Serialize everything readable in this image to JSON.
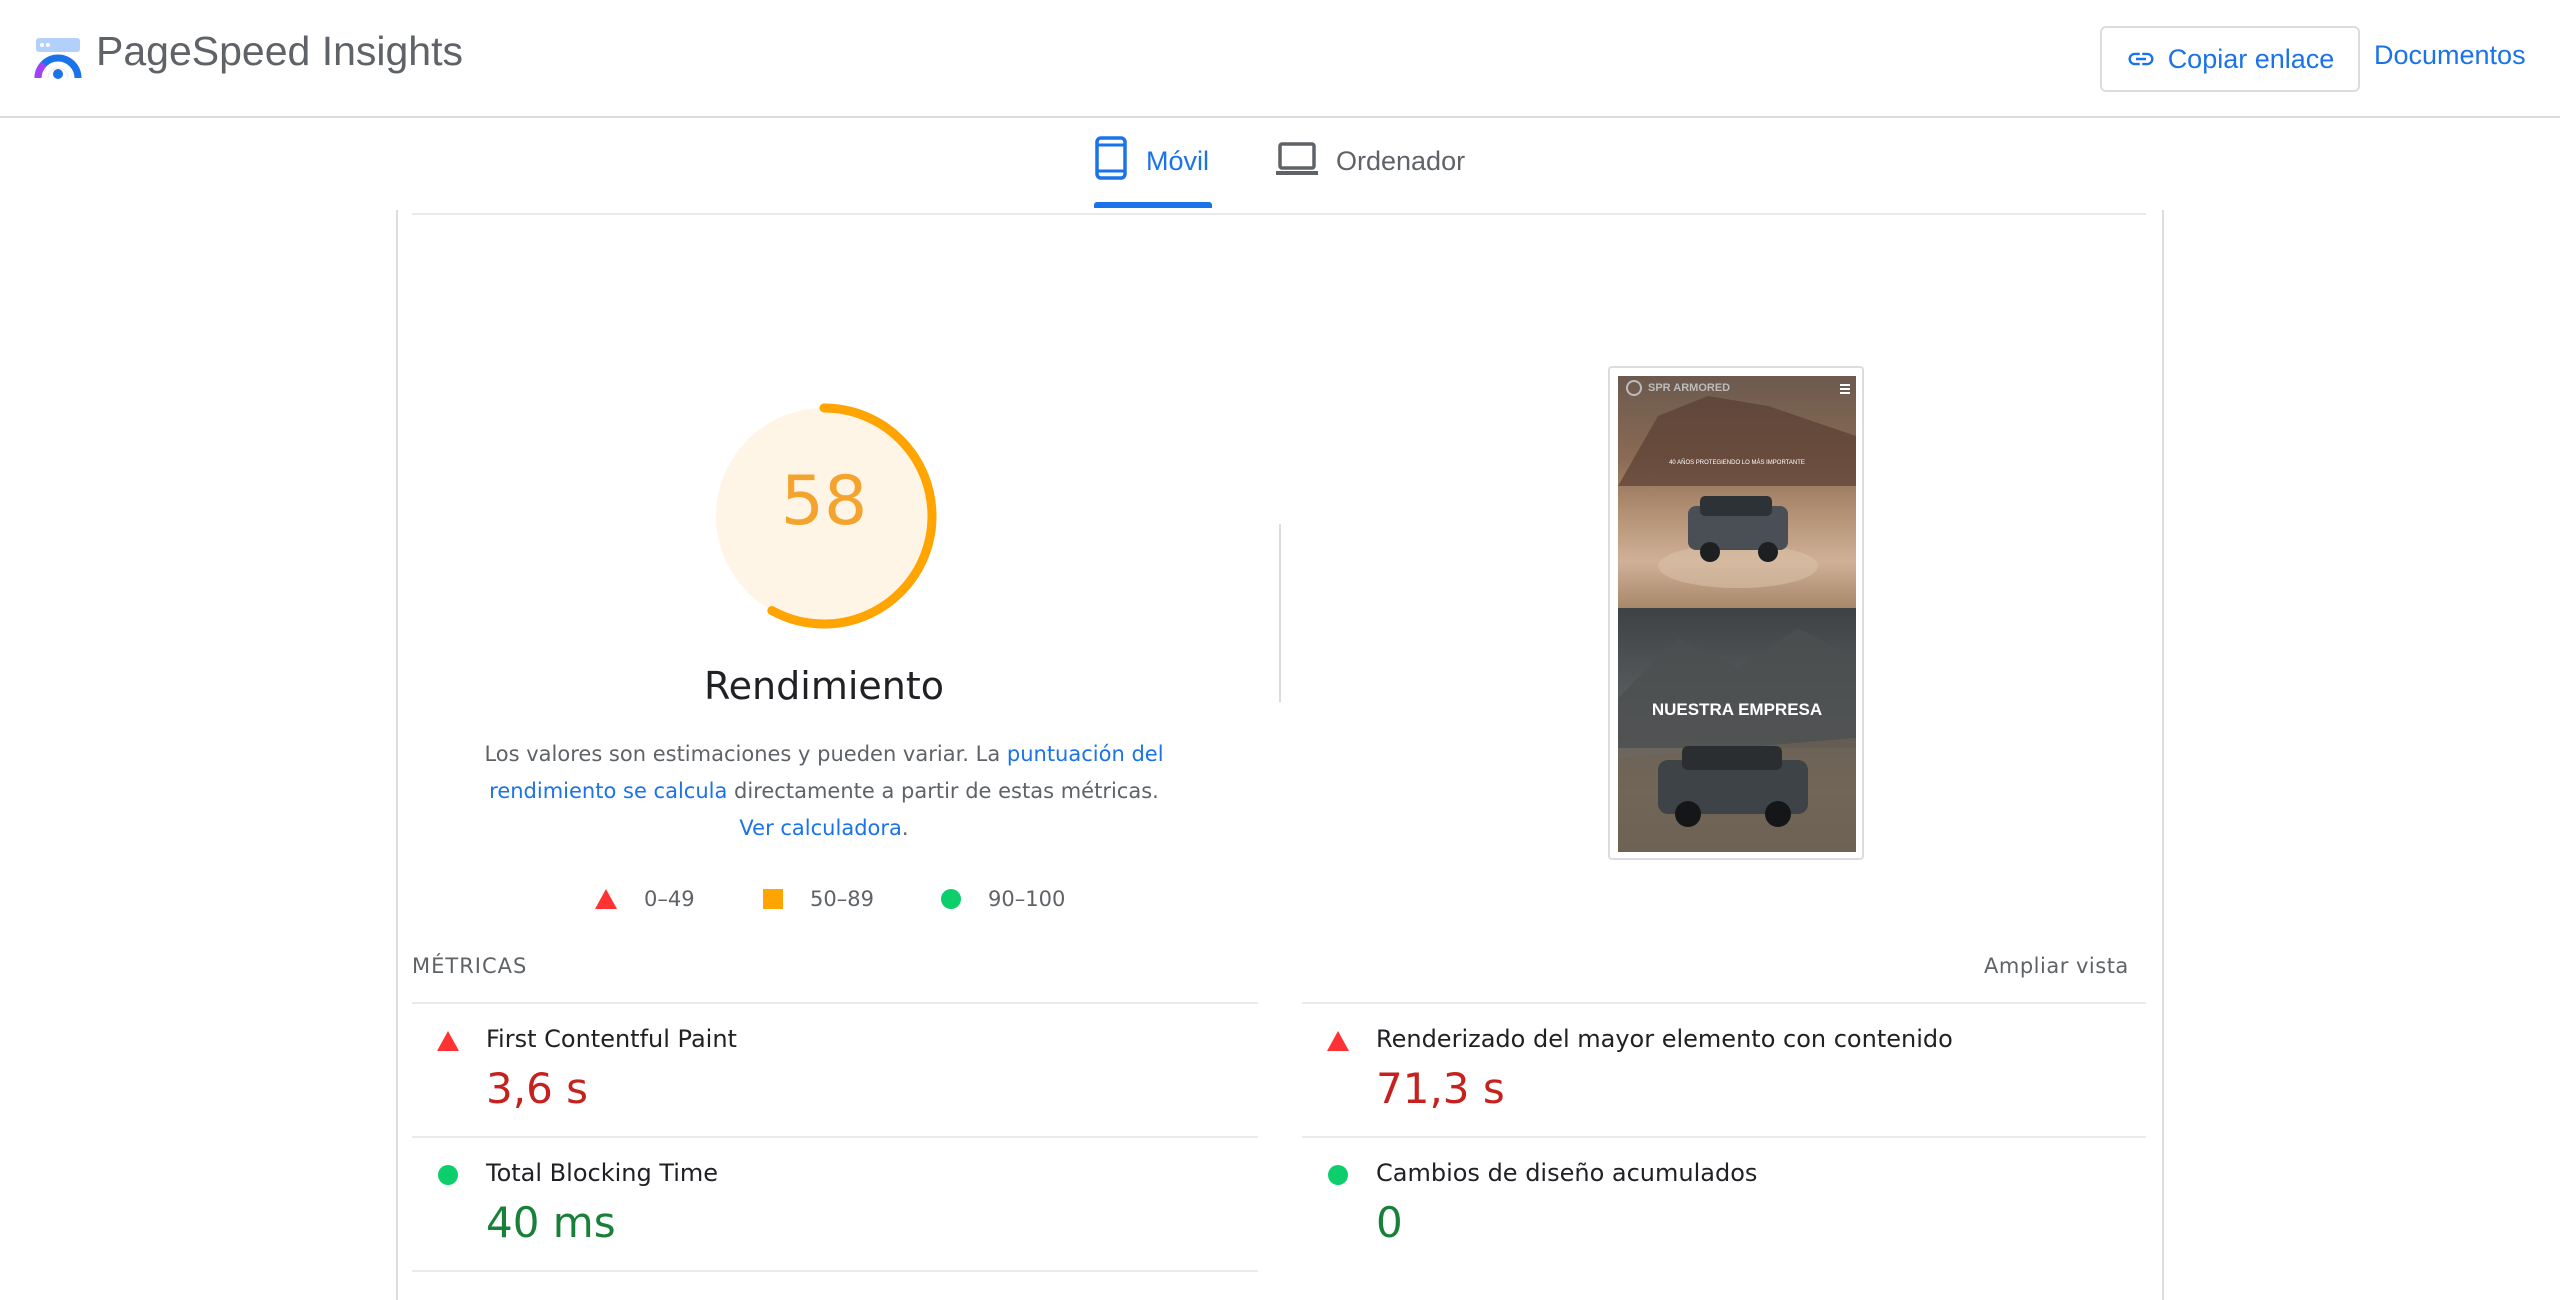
{
  "header": {
    "title": "PageSpeed Insights",
    "copy_link_label": "Copiar enlace",
    "docs_label": "Documentos"
  },
  "tabs": [
    {
      "label": "Móvil",
      "active": true
    },
    {
      "label": "Ordenador",
      "active": false
    }
  ],
  "performance": {
    "score": 58,
    "score_text": "58",
    "title": "Rendimiento",
    "desc_part1": "Los valores son estimaciones y pueden variar. La ",
    "desc_link1": "puntuación del rendimiento se calcula",
    "desc_part2": " directamente a partir de estas métricas. ",
    "desc_link2": "Ver calculadora",
    "desc_part3": "."
  },
  "legend": [
    {
      "range": "0–49"
    },
    {
      "range": "50–89"
    },
    {
      "range": "90–100"
    }
  ],
  "screenshot": {
    "brand": "SPR ARMORED",
    "tagline": "40 AÑOS PROTEGIENDO LO MÁS IMPORTANTE",
    "section_title": "NUESTRA EMPRESA"
  },
  "metrics": {
    "label": "MÉTRICAS",
    "expand_label": "Ampliar vista",
    "items": [
      {
        "name": "First Contentful Paint",
        "value": "3,6 s",
        "status": "fail"
      },
      {
        "name": "Renderizado del mayor elemento con contenido",
        "value": "71,3 s",
        "status": "fail"
      },
      {
        "name": "Total Blocking Time",
        "value": "40 ms",
        "status": "pass"
      },
      {
        "name": "Cambios de diseño acumulados",
        "value": "0",
        "status": "pass"
      }
    ]
  },
  "colors": {
    "accent": "#1a73e8",
    "average": "#ffa400",
    "fail": "#ff3333",
    "pass": "#0cce6b"
  }
}
